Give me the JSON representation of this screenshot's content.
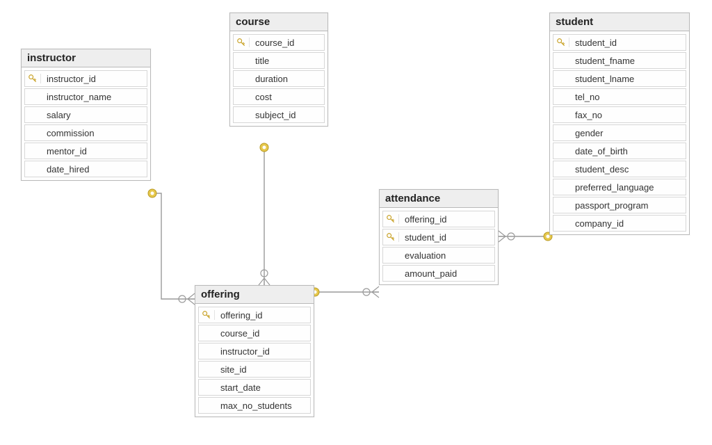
{
  "entities": {
    "instructor": {
      "title": "instructor",
      "fields": [
        {
          "name": "instructor_id",
          "pk": true
        },
        {
          "name": "instructor_name",
          "pk": false
        },
        {
          "name": "salary",
          "pk": false
        },
        {
          "name": "commission",
          "pk": false
        },
        {
          "name": "mentor_id",
          "pk": false
        },
        {
          "name": "date_hired",
          "pk": false
        }
      ]
    },
    "course": {
      "title": "course",
      "fields": [
        {
          "name": "course_id",
          "pk": true
        },
        {
          "name": "title",
          "pk": false
        },
        {
          "name": "duration",
          "pk": false
        },
        {
          "name": "cost",
          "pk": false
        },
        {
          "name": "subject_id",
          "pk": false
        }
      ]
    },
    "offering": {
      "title": "offering",
      "fields": [
        {
          "name": "offering_id",
          "pk": true
        },
        {
          "name": "course_id",
          "pk": false
        },
        {
          "name": "instructor_id",
          "pk": false
        },
        {
          "name": "site_id",
          "pk": false
        },
        {
          "name": "start_date",
          "pk": false
        },
        {
          "name": "max_no_students",
          "pk": false
        }
      ]
    },
    "attendance": {
      "title": "attendance",
      "fields": [
        {
          "name": "offering_id",
          "pk": true
        },
        {
          "name": "student_id",
          "pk": true
        },
        {
          "name": "evaluation",
          "pk": false
        },
        {
          "name": "amount_paid",
          "pk": false
        }
      ]
    },
    "student": {
      "title": "student",
      "fields": [
        {
          "name": "student_id",
          "pk": true
        },
        {
          "name": "student_fname",
          "pk": false
        },
        {
          "name": "student_lname",
          "pk": false
        },
        {
          "name": "tel_no",
          "pk": false
        },
        {
          "name": "fax_no",
          "pk": false
        },
        {
          "name": "gender",
          "pk": false
        },
        {
          "name": "date_of_birth",
          "pk": false
        },
        {
          "name": "student_desc",
          "pk": false
        },
        {
          "name": "preferred_language",
          "pk": false
        },
        {
          "name": "passport_program",
          "pk": false
        },
        {
          "name": "company_id",
          "pk": false
        }
      ]
    }
  },
  "relationships": [
    {
      "from": "course.course_id",
      "to": "offering.course_id",
      "type": "one-to-many"
    },
    {
      "from": "instructor.instructor_id",
      "to": "offering.instructor_id",
      "type": "one-to-many"
    },
    {
      "from": "offering.offering_id",
      "to": "attendance.offering_id",
      "type": "one-to-many"
    },
    {
      "from": "student.student_id",
      "to": "attendance.student_id",
      "type": "one-to-many"
    }
  ],
  "icons": {
    "key_color": "#e6c84d"
  }
}
